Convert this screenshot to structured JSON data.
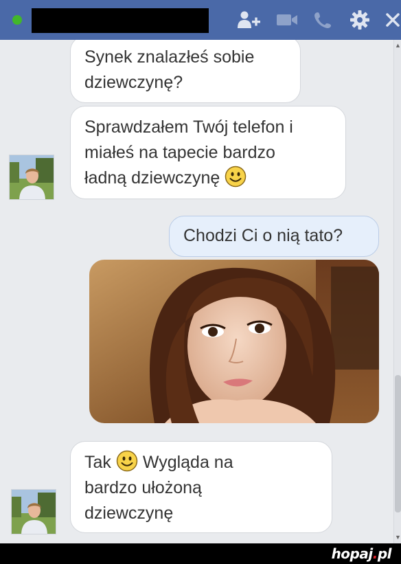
{
  "header": {
    "status": "online",
    "icons": [
      "add-friend-icon",
      "video-call-icon",
      "phone-icon",
      "gear-icon",
      "close-icon"
    ],
    "icon_color": "#dfe5f1",
    "bar_color": "#4a69a8"
  },
  "messages": [
    {
      "sender": "contact",
      "lines": [
        "Synek znalazłeś sobie",
        "dziewczynę?"
      ]
    },
    {
      "sender": "contact",
      "lines": [
        "Sprawdzałem Twój telefon i",
        "miałeś na tapecie bardzo",
        "ładną dziewczynę"
      ],
      "emoji": "smiley-emoji"
    },
    {
      "sender": "me",
      "lines": [
        "Chodzi Ci o nią tato?"
      ]
    },
    {
      "sender": "me",
      "type": "photo",
      "alt": "photo-portrait"
    },
    {
      "sender": "contact",
      "lines": [
        "Tak",
        "Wygląda na",
        "bardzo ułożoną",
        "dziewczynę"
      ],
      "emoji": "smiley-emoji"
    }
  ],
  "watermark": {
    "brand": "hopaj",
    "dot": ".",
    "tld": "pl"
  }
}
